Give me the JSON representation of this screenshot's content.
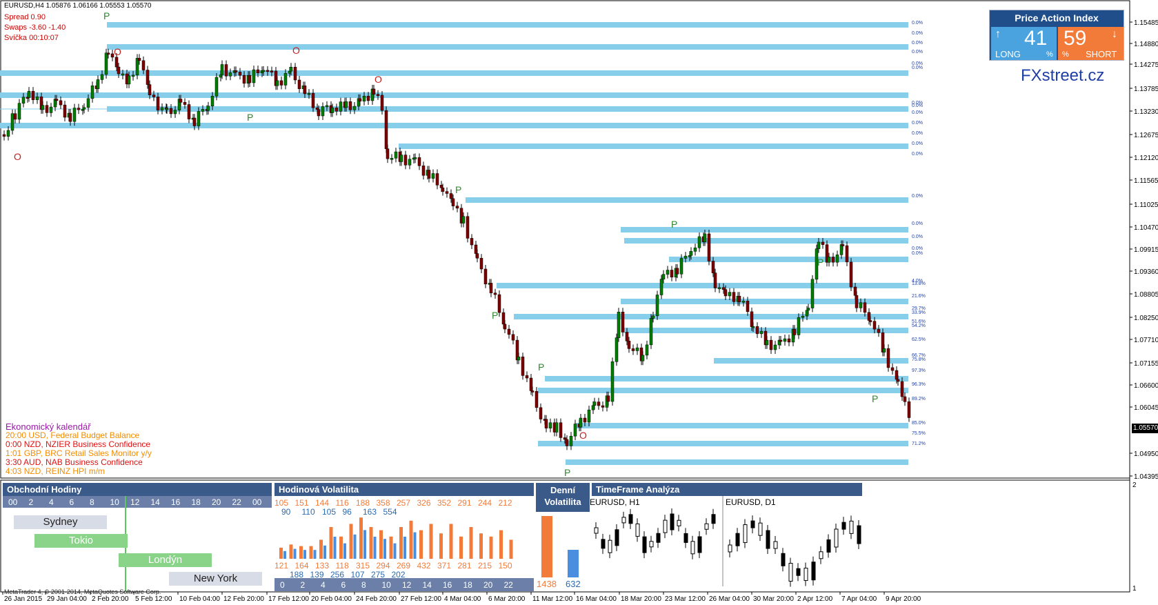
{
  "symbol_line": "EURUSD,H4  1.05876 1.06166 1.05553 1.05570",
  "info": {
    "spread": "Spread  0.90",
    "swaps": "Swaps  -3.60 -1.40",
    "candle": "Svíčka  00:10:07"
  },
  "price_action_index": {
    "title": "Price Action Index",
    "long_value": "41",
    "long_label": "LONG",
    "short_value": "59",
    "short_label": "SHORT",
    "pct": "%"
  },
  "brand": "FXstreet.cz",
  "current_price": "1.05570",
  "price_axis": [
    "1.15485",
    "1.14880",
    "1.14275",
    "1.13785",
    "1.13230",
    "1.12675",
    "1.12120",
    "1.11565",
    "1.11025",
    "1.10470",
    "1.09915",
    "1.09360",
    "1.08805",
    "1.08250",
    "1.07710",
    "1.07155",
    "1.06600",
    "1.06045",
    "1.04950",
    "1.04395"
  ],
  "time_axis": [
    "26 Jan 2015",
    "29 Jan 04:00",
    "2 Feb 20:00",
    "5 Feb 12:00",
    "10 Feb 04:00",
    "12 Feb 20:00",
    "17 Feb 12:00",
    "20 Feb 04:00",
    "24 Feb 20:00",
    "27 Feb 12:00",
    "4 Mar 04:00",
    "6 Mar 20:00",
    "11 Mar 12:00",
    "16 Mar 04:00",
    "18 Mar 20:00",
    "23 Mar 12:00",
    "26 Mar 04:00",
    "30 Mar 20:00",
    "2 Apr 12:00",
    "7 Apr 04:00",
    "9 Apr 20:00"
  ],
  "level_labels": [
    "0.0%",
    "0.0%",
    "0.0%",
    "0.0%",
    "0.0%",
    "0.0%",
    "0.0%",
    "0.0%",
    "0.0%",
    "0.0%",
    "0.0%",
    "0.0%",
    "0.0%",
    "0.0%",
    "0.0%",
    "0.0%",
    "0.0%",
    "0.0%",
    "4.0%",
    "13.8%",
    "21.6%",
    "29.7%",
    "33.9%",
    "51.6%",
    "54.2%",
    "62.5%",
    "66.7%",
    "75.8%",
    "97.3%",
    "96.3%",
    "89.2%",
    "85.0%",
    "75.5%",
    "71.2%"
  ],
  "calendar": {
    "title": "Ekonomický kalendář",
    "items": [
      {
        "text": "20:00 USD, Federal Budget Balance",
        "color": "#f28c00"
      },
      {
        "text": "0:00 NZD, NZIER Business Confidence",
        "color": "#e01010"
      },
      {
        "text": "1:01 GBP, BRC Retail Sales Monitor y/y",
        "color": "#f28c00"
      },
      {
        "text": "3:30 AUD, NAB Business Confidence",
        "color": "#e01010"
      },
      {
        "text": "4:03 NZD, REINZ HPI m/m",
        "color": "#f28c00"
      }
    ]
  },
  "trading_hours": {
    "title": "Obchodní Hodiny",
    "hours": [
      "00",
      "2",
      "4",
      "6",
      "8",
      "10",
      "12",
      "14",
      "16",
      "18",
      "20",
      "22",
      "00"
    ],
    "sessions": [
      "Sydney",
      "Tokio",
      "Londýn",
      "New York"
    ]
  },
  "hourly_vol": {
    "title": "Hodinová Volatilita",
    "top_row1": [
      "105",
      "151",
      "144",
      "116",
      "188",
      "358",
      "257",
      "326",
      "352",
      "291",
      "244",
      "212"
    ],
    "top_row2": [
      "90",
      "110",
      "105",
      "96",
      "163",
      "554"
    ],
    "bottom_row1": [
      "121",
      "164",
      "133",
      "118",
      "315",
      "294",
      "269",
      "432",
      "371",
      "281",
      "215",
      "150"
    ],
    "bottom_row2": [
      "188",
      "139",
      "256",
      "107",
      "275",
      "202"
    ],
    "hours": [
      "0",
      "2",
      "4",
      "6",
      "8",
      "10",
      "12",
      "14",
      "16",
      "18",
      "20",
      "22"
    ]
  },
  "daily_vol": {
    "title_line1": "Denní",
    "title_line2": "Volatilita",
    "value1": "1438",
    "value2": "632"
  },
  "tf_analysis": {
    "title": "TimeFrame Analýza",
    "left": "EURUSD, H1",
    "right": "EURUSD, D1"
  },
  "sub_axis": {
    "top": "2",
    "bottom": "1"
  },
  "copyright": "MetaTrader 4, © 2001-2014, MetaQuotes Software Corp.",
  "colors": {
    "level": "#87ceeb",
    "bull": "#008000",
    "bear": "#800000",
    "header": "#3a5a8a"
  }
}
